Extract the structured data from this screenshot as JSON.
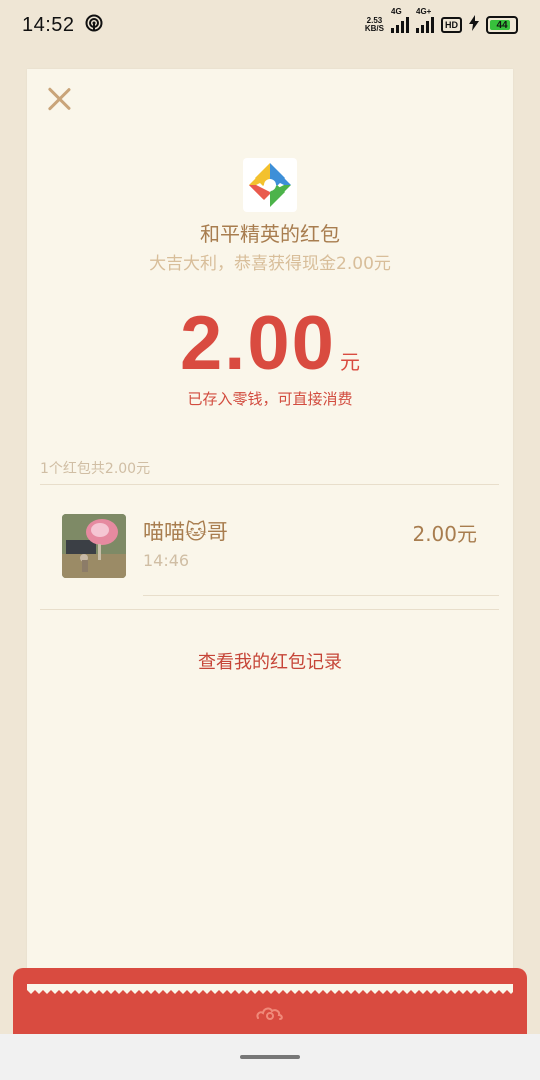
{
  "status_bar": {
    "time": "14:52",
    "speed_value": "2.53",
    "speed_unit": "KB/S",
    "net1": "4G",
    "net2": "4G+",
    "hd": "HD",
    "battery": "44"
  },
  "packet": {
    "sender_title": "和平精英的红包",
    "greeting": "大吉大利，恭喜获得现金2.00元",
    "amount": "2.00",
    "amount_unit": "元",
    "stored_note": "已存入零钱，可直接消费",
    "summary": "1个红包共2.00元"
  },
  "recipients": [
    {
      "name": "喵喵🐱哥",
      "time": "14:46",
      "amount": "2.00元"
    }
  ],
  "record_link": "查看我的红包记录",
  "colors": {
    "page_bg": "#EFE6D5",
    "card_bg": "#FAF6EA",
    "red": "#D94B40",
    "gold_text": "#A87D4F"
  },
  "icons": [
    "wifi-hotspot-icon",
    "signal-icon",
    "hd-icon",
    "charging-icon",
    "battery-icon",
    "close-icon",
    "app-logo-icon",
    "cloud-icon"
  ]
}
